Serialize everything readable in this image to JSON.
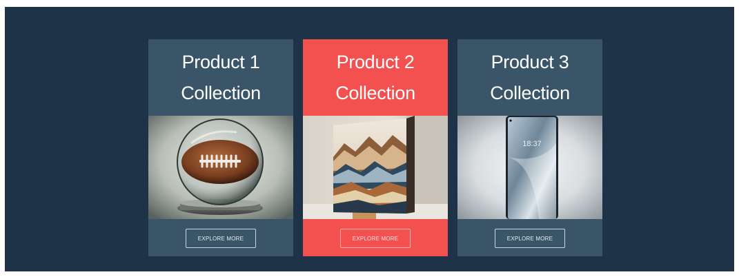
{
  "products": [
    {
      "title_line1": "Product 1",
      "title_line2": "Collection",
      "image_icon": "football-in-glass-sphere-image",
      "button_label": "EXPLORE MORE",
      "active": false
    },
    {
      "title_line1": "Product 2",
      "title_line2": "Collection",
      "image_icon": "mountain-painting-canvas-image",
      "button_label": "EXPLORE MORE",
      "active": true
    },
    {
      "title_line1": "Product 3",
      "title_line2": "Collection",
      "image_icon": "smartphone-image",
      "button_label": "EXPLORE MORE",
      "active": false,
      "phone_clock": "18:37"
    }
  ],
  "colors": {
    "background": "#1e3248",
    "card": "#3a5468",
    "card_active": "#f25150",
    "text": "#ffffff"
  }
}
